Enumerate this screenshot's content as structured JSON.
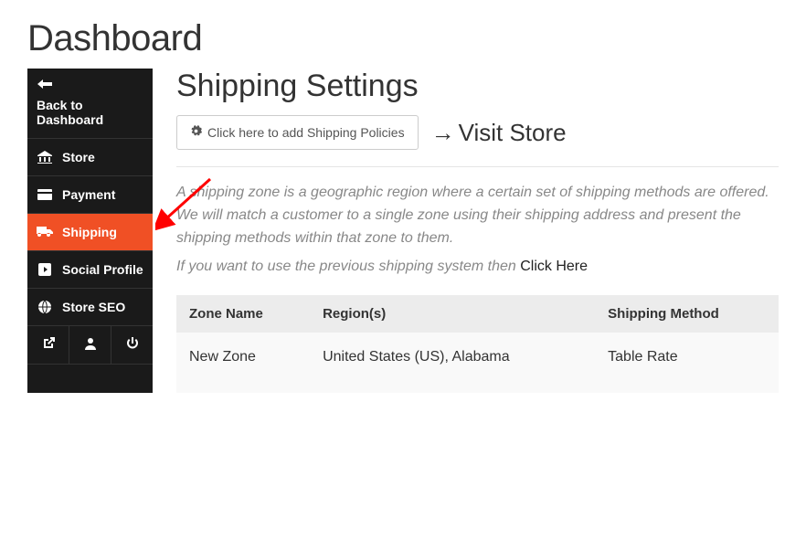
{
  "page_heading": "Dashboard",
  "sidebar": {
    "back": {
      "label": "Back to Dashboard"
    },
    "items": [
      {
        "label": "Store"
      },
      {
        "label": "Payment"
      },
      {
        "label": "Shipping"
      },
      {
        "label": "Social Profile"
      },
      {
        "label": "Store SEO"
      }
    ]
  },
  "main": {
    "title": "Shipping Settings",
    "policy_button": "Click here to add Shipping Policies",
    "visit_link": "Visit Store",
    "description": "A shipping zone is a geographic region where a certain set of shipping methods are offered. We will match a customer to a single zone using their shipping address and present the shipping methods within that zone to them.",
    "legacy_prefix": "If you want to use the previous shipping system then ",
    "legacy_link": "Click Here",
    "table": {
      "headers": {
        "zone": "Zone Name",
        "region": "Region(s)",
        "method": "Shipping Method"
      },
      "rows": [
        {
          "zone": "New Zone",
          "region": "United States (US), Alabama",
          "method": "Table Rate"
        }
      ]
    }
  }
}
